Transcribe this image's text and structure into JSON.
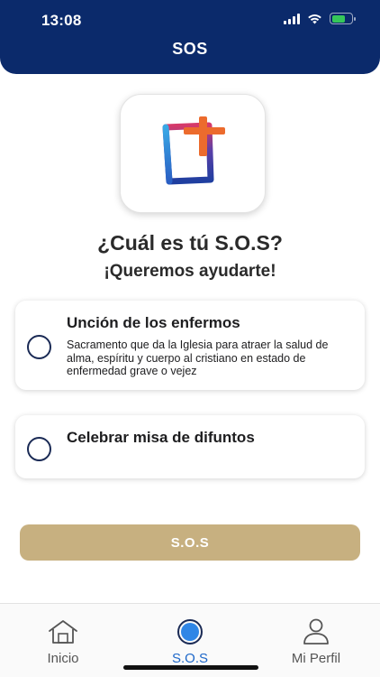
{
  "status_bar": {
    "time": "13:08"
  },
  "header": {
    "title": "SOS"
  },
  "logo": {
    "icon": "cross-logo-icon"
  },
  "main": {
    "heading": "¿Cuál es tú S.O.S?",
    "subheading": "¡Queremos ayudarte!"
  },
  "options": [
    {
      "title": "Unción de los enfermos",
      "description": "Sacramento que da la Iglesia para atraer la salud de alma, espíritu y cuerpo al cristiano en estado de enfermedad grave o vejez"
    },
    {
      "title": "Celebrar misa de difuntos",
      "description": ""
    }
  ],
  "sos_button": {
    "label": "S.O.S"
  },
  "tab_bar": {
    "tabs": [
      {
        "label": "Inicio",
        "icon": "home-icon"
      },
      {
        "label": "S.O.S",
        "icon": "sos-icon",
        "active": true
      },
      {
        "label": "Mi Perfil",
        "icon": "profile-icon"
      }
    ]
  },
  "colors": {
    "header": "#0b2a6b",
    "button": "#c7b080",
    "active_tab": "#1d67c9"
  }
}
